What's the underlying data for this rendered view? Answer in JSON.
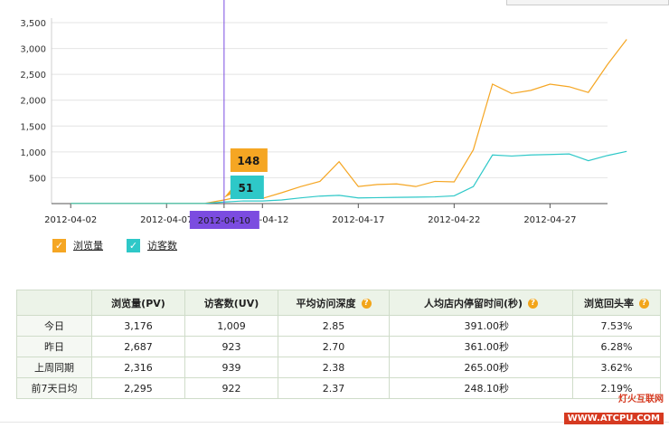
{
  "chart_data": {
    "type": "line",
    "x": [
      "2012-04-01",
      "2012-04-02",
      "2012-04-03",
      "2012-04-04",
      "2012-04-05",
      "2012-04-06",
      "2012-04-07",
      "2012-04-08",
      "2012-04-09",
      "2012-04-10",
      "2012-04-11",
      "2012-04-12",
      "2012-04-13",
      "2012-04-14",
      "2012-04-15",
      "2012-04-16",
      "2012-04-17",
      "2012-04-18",
      "2012-04-19",
      "2012-04-20",
      "2012-04-21",
      "2012-04-22",
      "2012-04-23",
      "2012-04-24",
      "2012-04-25",
      "2012-04-26",
      "2012-04-27",
      "2012-04-28",
      "2012-04-29",
      "2012-04-30",
      "2012-05-01"
    ],
    "series": [
      {
        "name": "浏览量",
        "color": "#f5a623",
        "values": [
          5,
          5,
          5,
          5,
          5,
          5,
          5,
          5,
          70,
          148,
          100,
          210,
          330,
          430,
          810,
          330,
          370,
          380,
          330,
          430,
          420,
          1040,
          2310,
          2130,
          2190,
          2310,
          2260,
          2150,
          2690,
          3176
        ]
      },
      {
        "name": "访客数",
        "color": "#2ec8c8",
        "values": [
          3,
          3,
          3,
          3,
          3,
          3,
          3,
          3,
          30,
          51,
          50,
          70,
          110,
          145,
          160,
          110,
          115,
          120,
          125,
          130,
          150,
          330,
          940,
          920,
          940,
          950,
          960,
          830,
          930,
          1009
        ]
      }
    ],
    "x_ticks": [
      "2012-04-02",
      "2012-04-07",
      "2012-04-10",
      "2012-04-12",
      "2012-04-17",
      "2012-04-22",
      "2012-04-27"
    ],
    "y_ticks": [
      500,
      1000,
      1500,
      2000,
      2500,
      3000,
      3500
    ],
    "y_tick_labels": [
      "500",
      "1,000",
      "1,500",
      "2,000",
      "2,500",
      "3,000",
      "3,500"
    ],
    "ylim": [
      0,
      3500
    ],
    "grid": true,
    "tooltip": {
      "date": "2012-04-10",
      "pv": "148",
      "uv": "51"
    }
  },
  "legend": [
    {
      "label": "浏览量",
      "color": "#f5a623"
    },
    {
      "label": "访客数",
      "color": "#2ec8c8"
    }
  ],
  "table": {
    "headers": [
      "",
      "浏览量(PV)",
      "访客数(UV)",
      "平均访问深度",
      "人均店内停留时间(秒)",
      "浏览回头率"
    ],
    "help_columns": [
      3,
      4,
      5
    ],
    "rows": [
      [
        "今日",
        "3,176",
        "1,009",
        "2.85",
        "391.00秒",
        "7.53%"
      ],
      [
        "昨日",
        "2,687",
        "923",
        "2.70",
        "361.00秒",
        "6.28%"
      ],
      [
        "上周同期",
        "2,316",
        "939",
        "2.38",
        "265.00秒",
        "3.62%"
      ],
      [
        "前7天日均",
        "2,295",
        "922",
        "2.37",
        "248.10秒",
        "2.19%"
      ]
    ]
  },
  "watermark": {
    "brand": "灯火互联网",
    "url": "WWW.ATCPU.COM"
  }
}
